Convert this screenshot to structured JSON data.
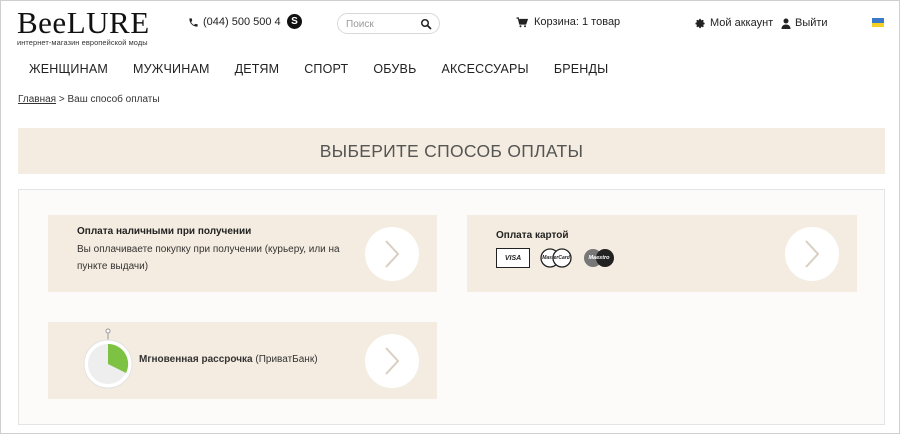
{
  "header": {
    "logo_main": "BeeLURE",
    "logo_sub": "интернет-магазин европейской моды",
    "phone": "(044) 500 500 4",
    "search_placeholder": "Поиск",
    "cart_label": "Корзина: 1 товар",
    "account_label": "Мой аккаунт",
    "logout_label": "Выйти",
    "icons": [
      "phone-icon",
      "skype-icon",
      "search-icon",
      "cart-icon",
      "gear-icon",
      "user-icon",
      "ukraine-flag-icon"
    ]
  },
  "nav": {
    "items": [
      "ЖЕНЩИНАМ",
      "МУЖЧИНАМ",
      "ДЕТЯМ",
      "СПОРТ",
      "ОБУВЬ",
      "АКСЕССУАРЫ",
      "БРЕНДЫ"
    ]
  },
  "breadcrumb": {
    "home": "Главная",
    "separator": ">",
    "current": "Ваш способ оплаты"
  },
  "page_title": "ВЫБЕРИТЕ СПОСОБ ОПЛАТЫ",
  "payment_options": {
    "cash": {
      "title": "Оплата наличными при получении",
      "desc_line1": "Вы оплачиваете покупку при получении (курьеру, или на",
      "desc_line2": "пункте выдачи)"
    },
    "card": {
      "title": "Оплата картой",
      "badges": [
        "VISA",
        "MasterCard",
        "Maestro"
      ]
    },
    "installment": {
      "title": "Мгновенная рассрочка",
      "subtitle": "(ПриватБанк)"
    }
  },
  "colors": {
    "accent_bg": "#f4ece0",
    "installment_green": "#7dc242"
  }
}
